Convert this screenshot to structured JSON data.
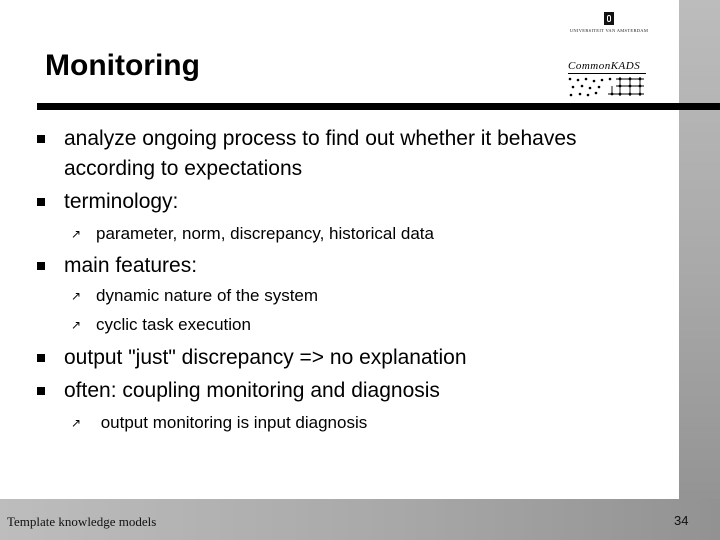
{
  "slide": {
    "title": "Monitoring",
    "logos": {
      "university": "UNIVERSITEIT VAN AMSTERDAM",
      "methodology": "CommonKADS"
    },
    "bullets": [
      {
        "level": 1,
        "lines": [
          "analyze ongoing process to find out whether it behaves",
          "according to expectations"
        ]
      },
      {
        "level": 1,
        "lines": [
          "terminology:"
        ]
      },
      {
        "level": 2,
        "lines": [
          "parameter, norm, discrepancy, historical data"
        ]
      },
      {
        "level": 1,
        "lines": [
          "main features:"
        ]
      },
      {
        "level": 2,
        "lines": [
          "dynamic nature of the system"
        ]
      },
      {
        "level": 2,
        "lines": [
          "cyclic task execution"
        ]
      },
      {
        "level": 1,
        "lines": [
          "output \"just\" discrepancy => no explanation"
        ]
      },
      {
        "level": 1,
        "lines": [
          "often: coupling monitoring and diagnosis"
        ]
      },
      {
        "level": 2,
        "lines": [
          " output monitoring is input diagnosis"
        ]
      }
    ],
    "footer": {
      "text": "Template knowledge models",
      "page_number": "34"
    },
    "icons": {
      "level1_bullet": "square-bullet-icon",
      "level2_bullet": "north-east-arrow-icon",
      "arrow_glyph": "↗"
    },
    "colors": {
      "background": "#ffffff",
      "side_bar_top": "#bcbcbc",
      "side_bar_bottom": "#909090",
      "rule": "#000000"
    }
  }
}
